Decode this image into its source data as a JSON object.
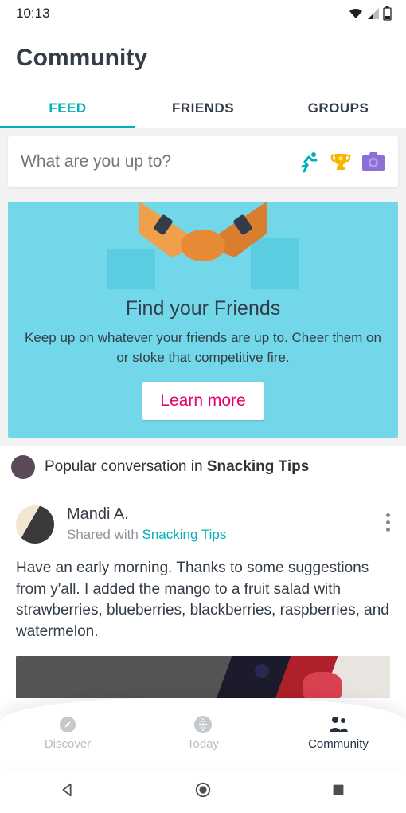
{
  "status": {
    "time": "10:13"
  },
  "page": {
    "title": "Community"
  },
  "tabs": [
    {
      "label": "FEED",
      "active": true
    },
    {
      "label": "FRIENDS",
      "active": false
    },
    {
      "label": "GROUPS",
      "active": false
    }
  ],
  "composer": {
    "placeholder": "What are you up to?"
  },
  "promo": {
    "title": "Find your Friends",
    "description": "Keep up on whatever your friends are up to. Cheer them on or stoke that competitive fire.",
    "button": "Learn more"
  },
  "conversation": {
    "prefix": "Popular conversation in ",
    "group": "Snacking Tips"
  },
  "post": {
    "author": "Mandi A.",
    "shared_prefix": "Shared with ",
    "shared_group": "Snacking Tips",
    "body": "Have an early morning. Thanks to some suggestions from y'all. I added the mango to a fruit salad with strawberries, blueberries, blackberries, raspberries, and watermelon."
  },
  "bottom_nav": [
    {
      "label": "Discover",
      "active": false
    },
    {
      "label": "Today",
      "active": false
    },
    {
      "label": "Community",
      "active": true
    }
  ]
}
